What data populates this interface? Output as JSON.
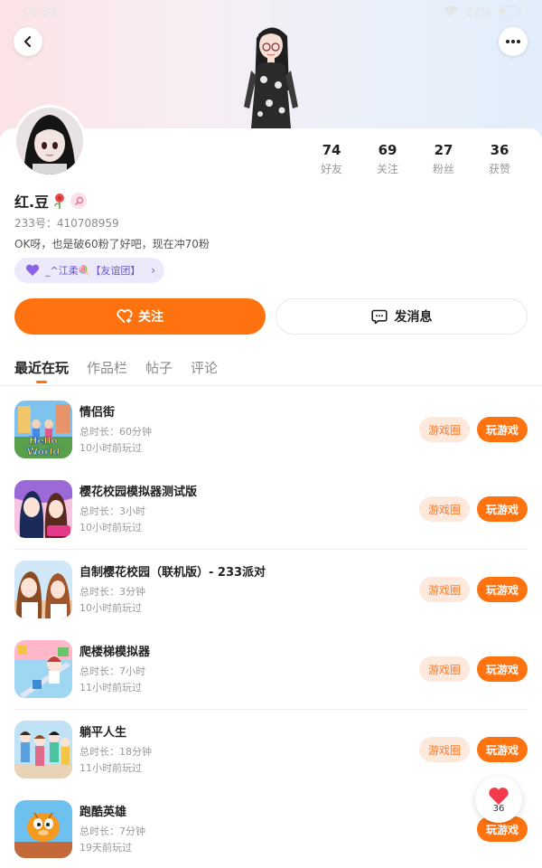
{
  "status_bar": {
    "time": "06:30",
    "battery": "23%"
  },
  "colors": {
    "accent": "#ff7210",
    "accent_light": "#fde8dc",
    "group_purple": "#6a55d1"
  },
  "header": {
    "back_icon": "chevron-left-icon",
    "more_icon": "more-dots-icon"
  },
  "profile": {
    "nickname": "红.豆",
    "id_label": "233号：410708959",
    "bio": "OK呀，也是破60粉了好吧，现在冲70粉",
    "group_chip": "_^江柔🍭【友谊团】",
    "stats": [
      {
        "value": "74",
        "label": "好友"
      },
      {
        "value": "69",
        "label": "关注"
      },
      {
        "value": "27",
        "label": "粉丝"
      },
      {
        "value": "36",
        "label": "获赞"
      }
    ],
    "follow_label": "关注",
    "message_label": "发消息"
  },
  "tabs": [
    {
      "label": "最近在玩",
      "active": true
    },
    {
      "label": "作品栏",
      "active": false
    },
    {
      "label": "帖子",
      "active": false
    },
    {
      "label": "评论",
      "active": false
    }
  ],
  "games": [
    {
      "title": "情侣街",
      "duration": "总时长：60分钟",
      "last_played": "10小时前玩过",
      "circle_label": "游戏圈",
      "play_label": "玩游戏"
    },
    {
      "title": "樱花校园模拟器测试版",
      "duration": "总时长：3小时",
      "last_played": "10小时前玩过",
      "circle_label": "游戏圈",
      "play_label": "玩游戏"
    },
    {
      "title": "自制樱花校园（联机版）- 233派对",
      "duration": "总时长：3分钟",
      "last_played": "10小时前玩过",
      "circle_label": "游戏圈",
      "play_label": "玩游戏"
    },
    {
      "title": "爬楼梯模拟器",
      "duration": "总时长：7小时",
      "last_played": "11小时前玩过",
      "circle_label": "游戏圈",
      "play_label": "玩游戏"
    },
    {
      "title": "躺平人生",
      "duration": "总时长：18分钟",
      "last_played": "11小时前玩过",
      "circle_label": "游戏圈",
      "play_label": "玩游戏"
    },
    {
      "title": "跑酷英雄",
      "duration": "总时长：7分钟",
      "last_played": "19天前玩过",
      "circle_label": "",
      "play_label": "玩游戏"
    }
  ],
  "like_float": {
    "count": "36"
  }
}
